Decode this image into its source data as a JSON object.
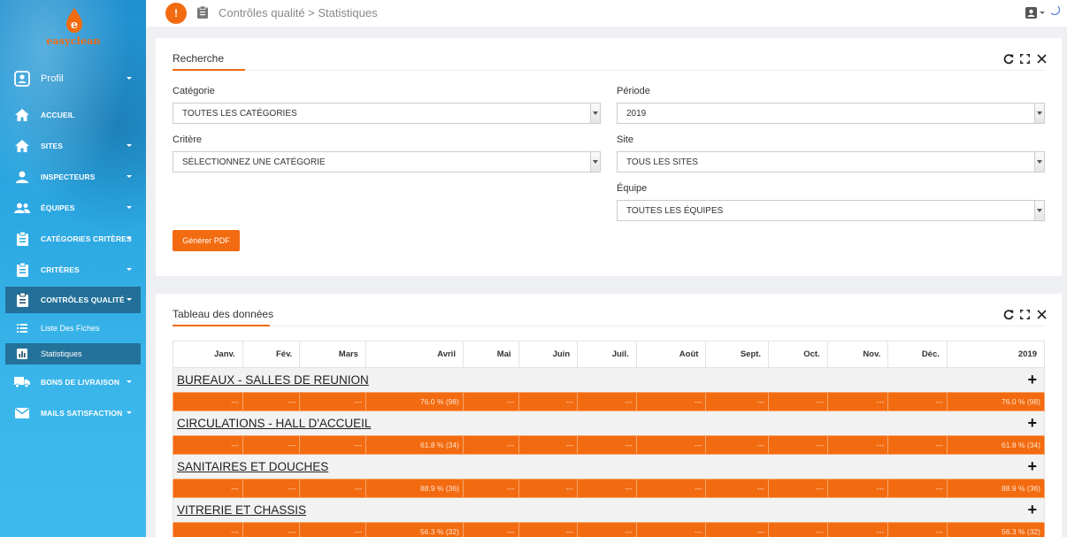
{
  "brand": {
    "name": "easyclean"
  },
  "topbar": {
    "alert_icon": "!",
    "breadcrumb": "Contrôles qualité > Statistiques"
  },
  "sidebar": {
    "profile": "Profil",
    "items": [
      {
        "label": "Accueil",
        "icon": "home-icon"
      },
      {
        "label": "Sites",
        "icon": "home-icon"
      },
      {
        "label": "Inspecteurs",
        "icon": "user-icon"
      },
      {
        "label": "Équipes",
        "icon": "users-icon"
      },
      {
        "label": "Catégories critères",
        "icon": "clipboard-icon"
      },
      {
        "label": "Critères",
        "icon": "clipboard-icon"
      },
      {
        "label": "Contrôles qualité",
        "icon": "clipboard-icon"
      },
      {
        "label": "Bons de livraison",
        "icon": "truck-icon"
      },
      {
        "label": "Mails satisfaction",
        "icon": "mail-icon"
      }
    ],
    "sub": [
      {
        "label": "Liste Des Fiches",
        "icon": "list-icon"
      },
      {
        "label": "Statistiques",
        "icon": "bar-chart-icon"
      }
    ]
  },
  "search": {
    "title": "Recherche",
    "categorie_label": "Catégorie",
    "categorie_value": "Toutes les catégories",
    "critere_label": "Critère",
    "critere_value": "Sélectionnez une catégorie",
    "periode_label": "Période",
    "periode_value": "2019",
    "site_label": "Site",
    "site_value": "Tous les sites",
    "equipe_label": "Équipe",
    "equipe_value": "Toutes les équipes",
    "pdf_button": "Générer PDF"
  },
  "table": {
    "title": "Tableau des données",
    "headers": [
      "Janv.",
      "Fév.",
      "Mars",
      "Avril",
      "Mai",
      "Juin",
      "Juil.",
      "Août",
      "Sept.",
      "Oct.",
      "Nov.",
      "Déc.",
      "2019"
    ],
    "plus": "+",
    "rows": [
      {
        "name": "BUREAUX - SALLES DE REUNION",
        "values": [
          "---",
          "---",
          "---",
          "76.0 % (98)",
          "---",
          "---",
          "---",
          "---",
          "---",
          "---",
          "---",
          "---",
          "76.0 % (98)"
        ]
      },
      {
        "name": "CIRCULATIONS - HALL D'ACCUEIL",
        "values": [
          "---",
          "---",
          "---",
          "61.8 % (34)",
          "---",
          "---",
          "---",
          "---",
          "---",
          "---",
          "---",
          "---",
          "61.8 % (34)"
        ]
      },
      {
        "name": "SANITAIRES ET DOUCHES",
        "values": [
          "---",
          "---",
          "---",
          "88.9 % (36)",
          "---",
          "---",
          "---",
          "---",
          "---",
          "---",
          "---",
          "---",
          "88.9 % (36)"
        ]
      },
      {
        "name": "VITRERIE ET CHASSIS",
        "values": [
          "---",
          "---",
          "---",
          "56.3 % (32)",
          "---",
          "---",
          "---",
          "---",
          "---",
          "---",
          "---",
          "---",
          "56.3 % (32)"
        ]
      }
    ]
  },
  "colors": {
    "accent": "#f26b10",
    "sidebar": "#2aa6e0"
  }
}
